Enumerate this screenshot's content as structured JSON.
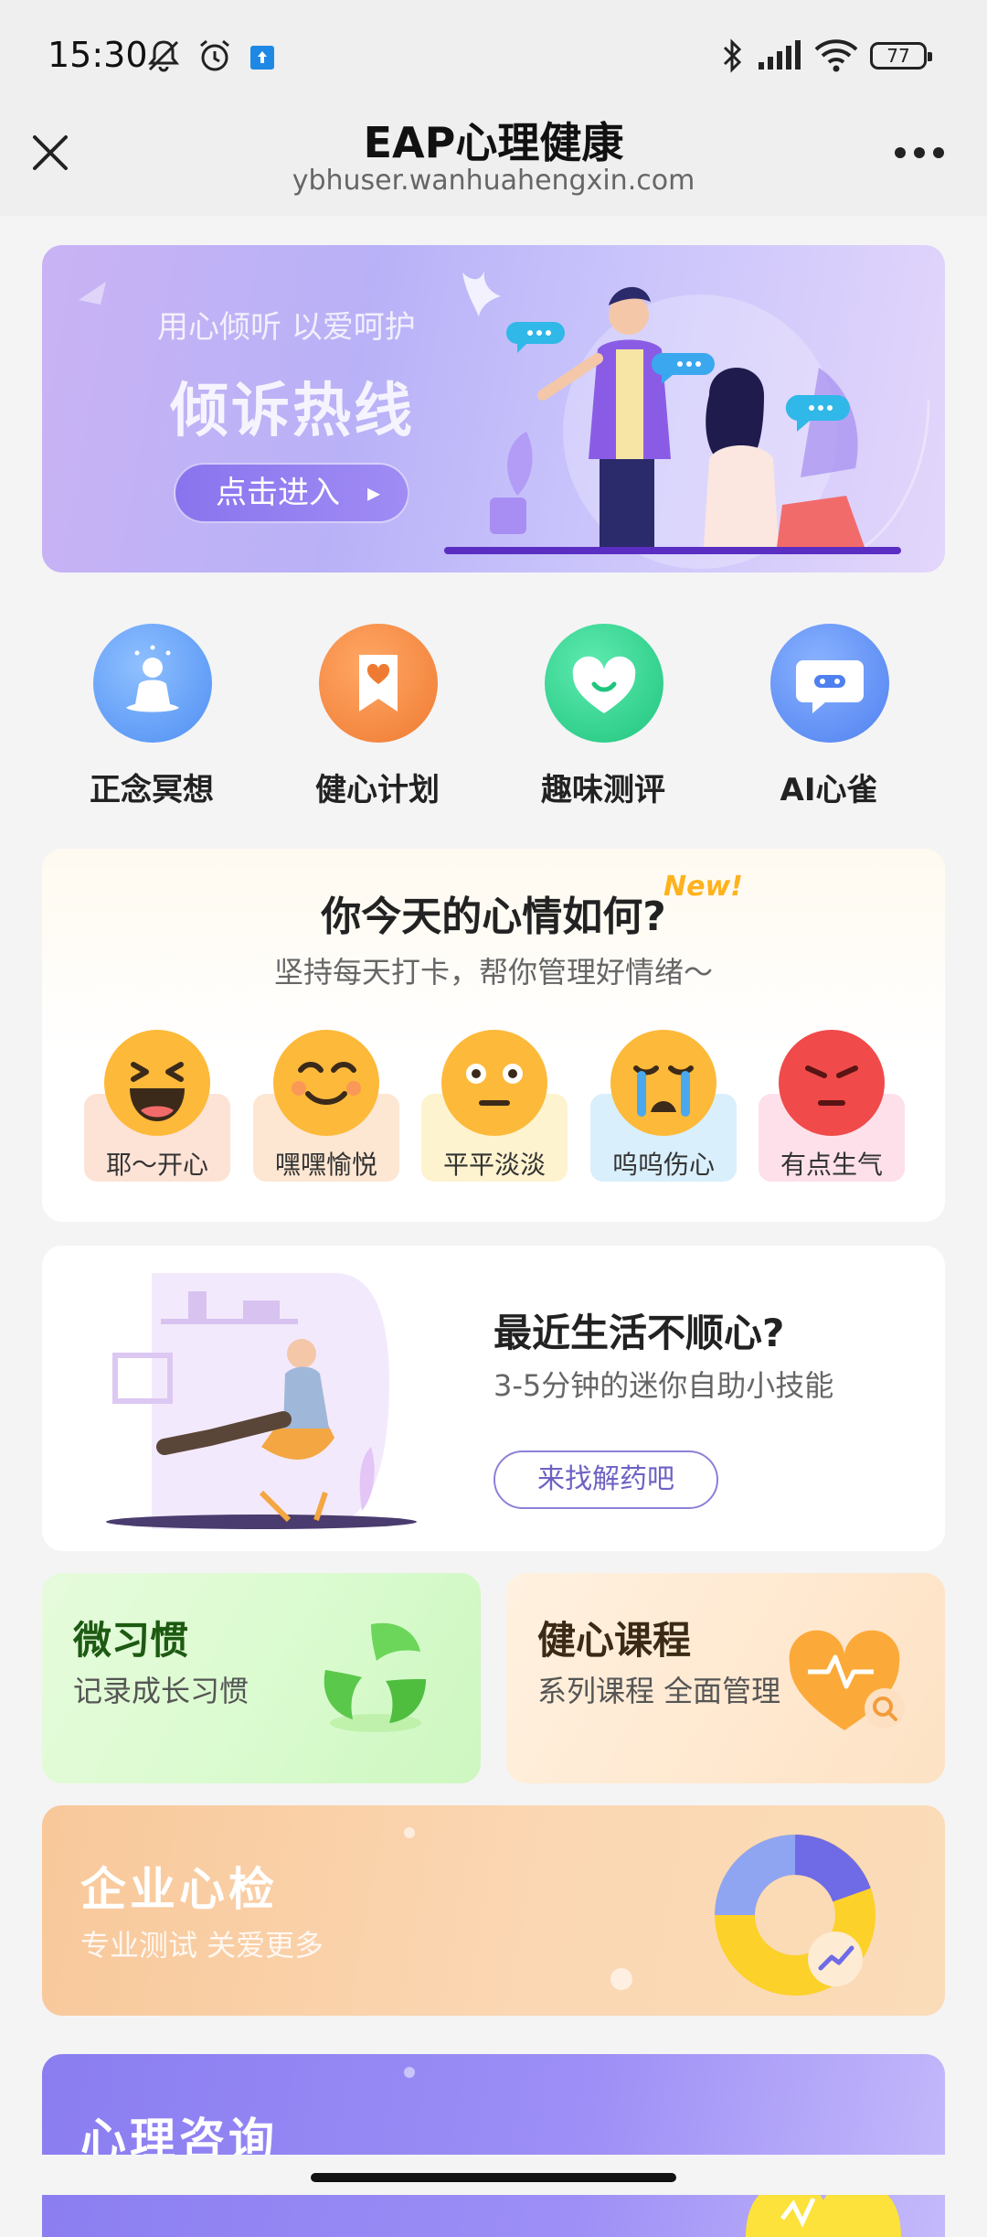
{
  "status_bar": {
    "time": "15:30",
    "battery": "77",
    "icons": [
      "mute-icon",
      "alarm-icon",
      "notification-icon",
      "bluetooth-icon",
      "signal-icon",
      "wifi-icon",
      "battery-icon"
    ]
  },
  "header": {
    "title": "EAP心理健康",
    "url": "ybhuser.wanhuahengxin.com",
    "close_icon": "close-icon",
    "more_icon": "more-icon"
  },
  "banner": {
    "subtitle": "用心倾听 以爱呵护",
    "title": "倾诉热线",
    "button": "点击进入"
  },
  "quick_entries": [
    {
      "label": "正念冥想",
      "icon": "meditation-icon",
      "color": "#5b9cf5"
    },
    {
      "label": "健心计划",
      "icon": "bookmark-heart-icon",
      "color": "#f0823a"
    },
    {
      "label": "趣味测评",
      "icon": "heart-icon",
      "color": "#2fd08a"
    },
    {
      "label": "AI心雀",
      "icon": "chat-bot-icon",
      "color": "#5a8cf5"
    }
  ],
  "mood": {
    "title": "你今天的心情如何?",
    "badge": "New!",
    "subtitle": "坚持每天打卡，帮你管理好情绪～",
    "options": [
      {
        "label": "耶～开心",
        "face": "laughing-face-icon",
        "tag_color": "#fde3d6"
      },
      {
        "label": "嘿嘿愉悦",
        "face": "smiling-face-icon",
        "tag_color": "#fde6d2"
      },
      {
        "label": "平平淡淡",
        "face": "neutral-face-icon",
        "tag_color": "#fef3cf"
      },
      {
        "label": "呜呜伤心",
        "face": "crying-face-icon",
        "tag_color": "#d9effb"
      },
      {
        "label": "有点生气",
        "face": "angry-face-icon",
        "tag_color": "#fde0ea"
      }
    ]
  },
  "life_card": {
    "title": "最近生活不顺心?",
    "subtitle": "3-5分钟的迷你自助小技能",
    "button": "来找解药吧"
  },
  "habit_card": {
    "title": "微习惯",
    "subtitle": "记录成长习惯"
  },
  "course_card": {
    "title": "健心课程",
    "subtitle": "系列课程 全面管理"
  },
  "enterprise_card": {
    "title": "企业心检",
    "subtitle": "专业测试 关爱更多"
  },
  "consult_card": {
    "title": "心理咨询"
  }
}
